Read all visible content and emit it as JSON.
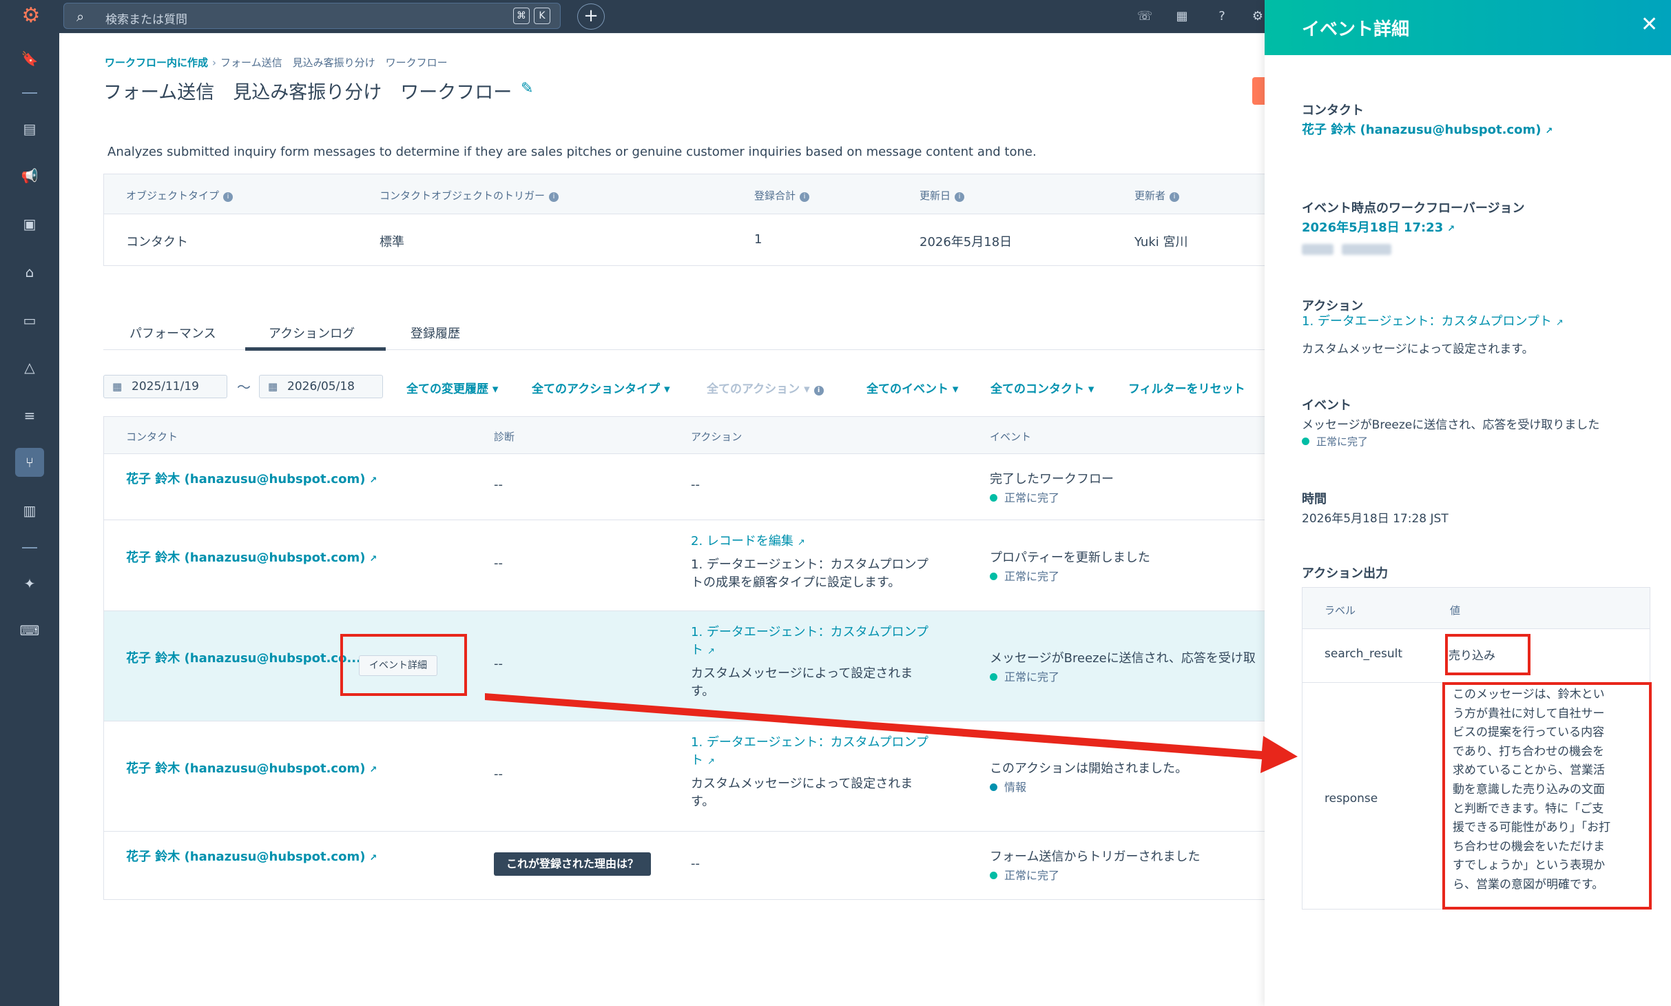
{
  "topbar": {
    "search_placeholder": "検索または質問",
    "shortcut_keys": [
      "⌘",
      "K"
    ]
  },
  "page": {
    "breadcrumb": [
      "ワークフロー内に作成",
      "フォーム送信　見込み客振り分け　ワークフロー"
    ],
    "title": "フォーム送信　見込み客振り分け　ワークフロー",
    "description": "Analyzes submitted inquiry form messages to determine if they are sales pitches or genuine customer inquiries based on message content and tone."
  },
  "meta": {
    "headers": [
      "オブジェクトタイプ",
      "コンタクトオブジェクトのトリガー",
      "登録合計",
      "更新日",
      "更新者"
    ],
    "values": [
      "コンタクト",
      "標準",
      "1",
      "2026年5月18日",
      "Yuki 宮川"
    ]
  },
  "tabs": [
    "パフォーマンス",
    "アクションログ",
    "登録履歴"
  ],
  "filters": {
    "date_from": "2025/11/19",
    "date_to": "2026/05/18",
    "tilde": "〜",
    "items": [
      "全ての変更履歴 ▾",
      "全てのアクションタイプ ▾",
      "全てのアクション ▾",
      "全てのイベント ▾",
      "全てのコンタクト ▾",
      "フィルターをリセット"
    ]
  },
  "log_table": {
    "headers": [
      "コンタクト",
      "診断",
      "アクション",
      "イベント"
    ],
    "rows": [
      {
        "contact": "花子 鈴木 (hanazusu@hubspot.com)",
        "diagnosis": "--",
        "action_link_1": "",
        "action_link_2": "",
        "action_text_1": "--",
        "action_text_2": "",
        "event": "完了したワークフロー",
        "status": "正常に完了"
      },
      {
        "contact": "花子 鈴木 (hanazusu@hubspot.com)",
        "diagnosis": "--",
        "action_link_1": "2. レコードを編集",
        "action_link_2": "",
        "action_text_1": "1. データエージェント：カスタムプロンプ",
        "action_text_2": "トの成果を顧客タイプに設定します。",
        "event": "プロパティーを更新しました",
        "status": "正常に完了"
      },
      {
        "contact": "花子 鈴木 (hanazusu@hubspot.co...",
        "event_detail_button": "イベント詳細",
        "diagnosis": "--",
        "action_link_1": "1. データエージェント：カスタムプロンプ",
        "action_link_2": "ト",
        "action_text_1": "カスタムメッセージによって設定されま",
        "action_text_2": "す。",
        "event": "メッセージがBreezeに送信され、応答を受け取",
        "status": "正常に完了"
      },
      {
        "contact": "花子 鈴木 (hanazusu@hubspot.com)",
        "diagnosis": "--",
        "action_link_1": "1. データエージェント：カスタムプロンプ",
        "action_link_2": "ト",
        "action_text_1": "カスタムメッセージによって設定されま",
        "action_text_2": "す。",
        "event": "このアクションは開始されました。",
        "status": "情報"
      },
      {
        "contact": "花子 鈴木 (hanazusu@hubspot.com)",
        "why_button": "これが登録された理由は？",
        "diagnosis": "",
        "action_link_1": "",
        "action_link_2": "",
        "action_text_1": "--",
        "action_text_2": "",
        "event": "フォーム送信からトリガーされました",
        "status": "正常に完了"
      }
    ]
  },
  "panel": {
    "title": "イベント詳細",
    "contact_label": "コンタクト",
    "contact_value": "花子 鈴木 (hanazusu@hubspot.com)",
    "version_label": "イベント時点のワークフローバージョン",
    "version_value": "2026年5月18日 17:23",
    "action_label": "アクション",
    "action_value": "1. データエージェント：カスタムプロンプト",
    "action_desc": "カスタムメッセージによって設定されます。",
    "event_label": "イベント",
    "event_value": "メッセージがBreezeに送信され、応答を受け取りました",
    "event_status": "正常に完了",
    "time_label": "時間",
    "time_value": "2026年5月18日 17:28 JST",
    "output_label": "アクション出力",
    "output_headers": [
      "ラベル",
      "値"
    ],
    "output_rows": [
      {
        "label": "search_result",
        "value": "売り込み"
      },
      {
        "label": "response",
        "value_lines": [
          "このメッセージは、鈴木とい",
          "う方が貴社に対して自社サー",
          "ビスの提案を行っている内容",
          "であり、打ち合わせの機会を",
          "求めていることから、営業活",
          "動を意識した売り込みの文面",
          "と判断できます。特に「ご支",
          "援できる可能性があり」「お打",
          "ち合わせの機会をいただけま",
          "すでしょうか」という表現か",
          "ら、営業の意図が明確です。"
        ]
      }
    ]
  },
  "colors": {
    "topbar": "#2d3e50",
    "link": "#0091ae",
    "success": "#00bda5",
    "highlight_row": "#e5f5f8",
    "annotation": "#e8261b",
    "hubspot_orange": "#ff7a59"
  }
}
